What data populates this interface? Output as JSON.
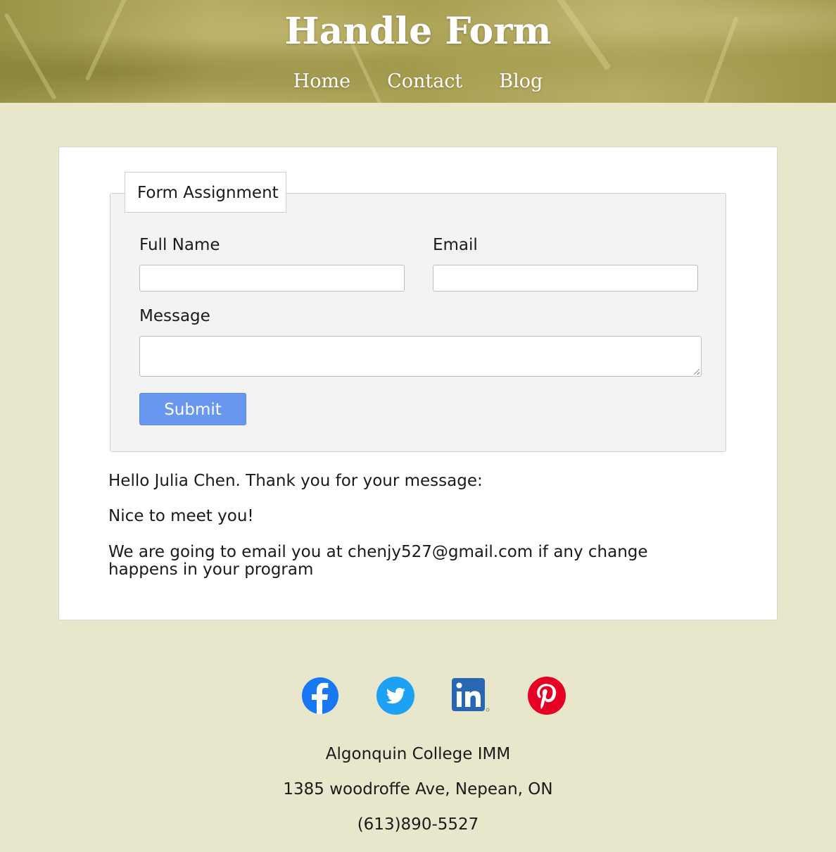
{
  "header": {
    "title": "Handle Form",
    "nav": [
      {
        "label": "Home"
      },
      {
        "label": "Contact"
      },
      {
        "label": "Blog"
      }
    ]
  },
  "form": {
    "legend": "Form Assignment",
    "full_name_label": "Full Name",
    "full_name_value": "",
    "email_label": "Email",
    "email_value": "",
    "message_label": "Message",
    "message_value": "",
    "submit_label": "Submit",
    "submit_color": "#6897f0"
  },
  "response": {
    "greeting": "Hello Julia Chen. Thank you for your message:",
    "message": "Nice to meet you!",
    "email_notice": "We are going to email you at chenjy527@gmail.com if any change happens in your program"
  },
  "footer": {
    "social": [
      {
        "icon": "facebook-icon",
        "color": "#1877f2"
      },
      {
        "icon": "twitter-icon",
        "color": "#1da1f2"
      },
      {
        "icon": "linkedin-icon",
        "color": "#2867b2"
      },
      {
        "icon": "pinterest-icon",
        "color": "#e60023"
      }
    ],
    "org": "Algonquin College IMM",
    "address": "1385 woodroffe Ave, Nepean, ON",
    "phone": "(613)890-5527"
  },
  "colors": {
    "page_background": "#e8e6cb",
    "card_background": "#ffffff",
    "fieldset_background": "#f3f3f3"
  }
}
